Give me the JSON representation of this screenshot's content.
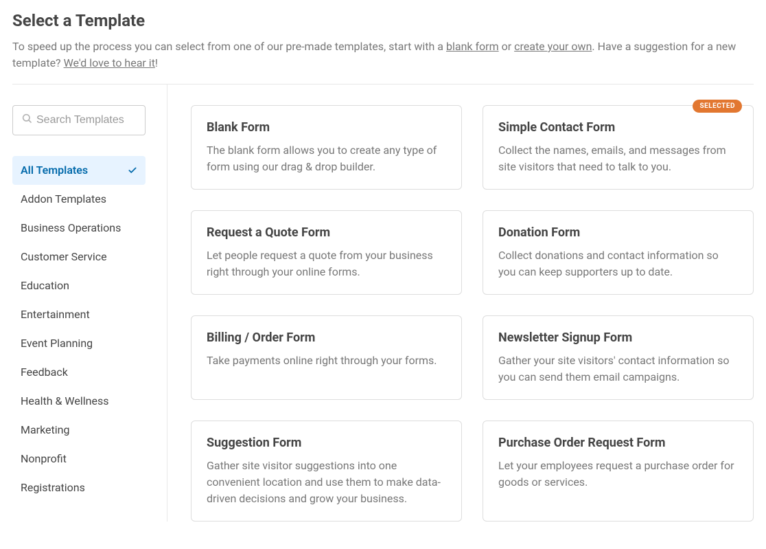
{
  "header": {
    "title": "Select a Template",
    "intro_prefix": "To speed up the process you can select from one of our pre-made templates, start with a ",
    "link_blank": "blank form",
    "intro_or": " or ",
    "link_create": "create your own",
    "intro_mid": ". Have a suggestion for a new template? ",
    "link_hear": "We'd love to hear it",
    "intro_suffix": "!"
  },
  "search": {
    "placeholder": "Search Templates"
  },
  "categories": [
    {
      "label": "All Templates",
      "active": true
    },
    {
      "label": "Addon Templates",
      "active": false
    },
    {
      "label": "Business Operations",
      "active": false
    },
    {
      "label": "Customer Service",
      "active": false
    },
    {
      "label": "Education",
      "active": false
    },
    {
      "label": "Entertainment",
      "active": false
    },
    {
      "label": "Event Planning",
      "active": false
    },
    {
      "label": "Feedback",
      "active": false
    },
    {
      "label": "Health & Wellness",
      "active": false
    },
    {
      "label": "Marketing",
      "active": false
    },
    {
      "label": "Nonprofit",
      "active": false
    },
    {
      "label": "Registrations",
      "active": false
    }
  ],
  "selected_badge": "SELECTED",
  "templates": [
    {
      "title": "Blank Form",
      "desc": "The blank form allows you to create any type of form using our drag & drop builder.",
      "selected": false
    },
    {
      "title": "Simple Contact Form",
      "desc": "Collect the names, emails, and messages from site visitors that need to talk to you.",
      "selected": true
    },
    {
      "title": "Request a Quote Form",
      "desc": "Let people request a quote from your business right through your online forms.",
      "selected": false
    },
    {
      "title": "Donation Form",
      "desc": "Collect donations and contact information so you can keep supporters up to date.",
      "selected": false
    },
    {
      "title": "Billing / Order Form",
      "desc": "Take payments online right through your forms.",
      "selected": false
    },
    {
      "title": "Newsletter Signup Form",
      "desc": "Gather your site visitors' contact information so you can send them email campaigns.",
      "selected": false
    },
    {
      "title": "Suggestion Form",
      "desc": "Gather site visitor suggestions into one convenient location and use them to make data-driven decisions and grow your business.",
      "selected": false
    },
    {
      "title": "Purchase Order Request Form",
      "desc": "Let your employees request a purchase order for goods or services.",
      "selected": false
    }
  ]
}
